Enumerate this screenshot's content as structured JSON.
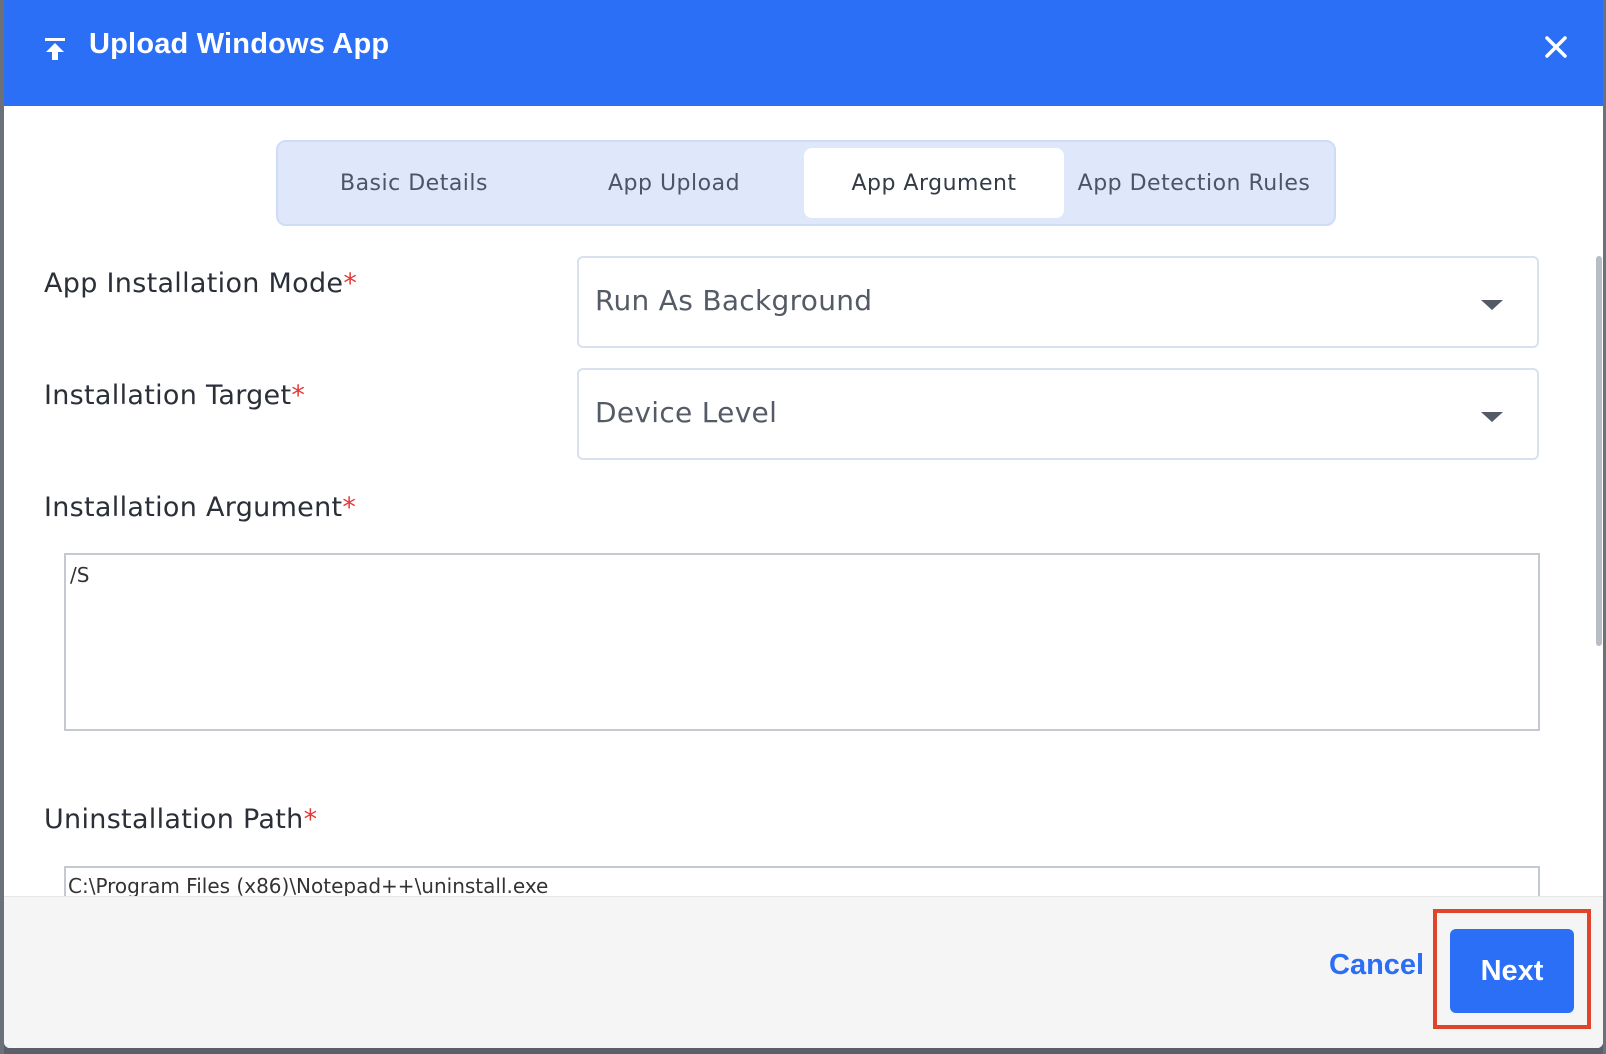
{
  "modal": {
    "title": "Upload Windows App",
    "header_icon": "upload-icon",
    "close_icon": "close-icon"
  },
  "tabs": [
    {
      "label": "Basic Details",
      "active": false
    },
    {
      "label": "App Upload",
      "active": false
    },
    {
      "label": "App Argument",
      "active": true
    },
    {
      "label": "App Detection Rules",
      "active": false
    }
  ],
  "form": {
    "install_mode": {
      "label": "App Installation Mode",
      "required_mark": "*",
      "value": "Run As Background"
    },
    "install_target": {
      "label": "Installation Target",
      "required_mark": "*",
      "value": "Device Level"
    },
    "install_argument": {
      "label": "Installation Argument",
      "required_mark": "*",
      "value": "/S"
    },
    "uninstall_path": {
      "label": "Uninstallation Path",
      "required_mark": "*",
      "value": "C:\\Program Files (x86)\\Notepad++\\uninstall.exe"
    }
  },
  "footer": {
    "cancel_label": "Cancel",
    "next_label": "Next"
  },
  "colors": {
    "primary": "#2a6ff5",
    "required": "#e53935",
    "highlight": "#e0452b"
  }
}
